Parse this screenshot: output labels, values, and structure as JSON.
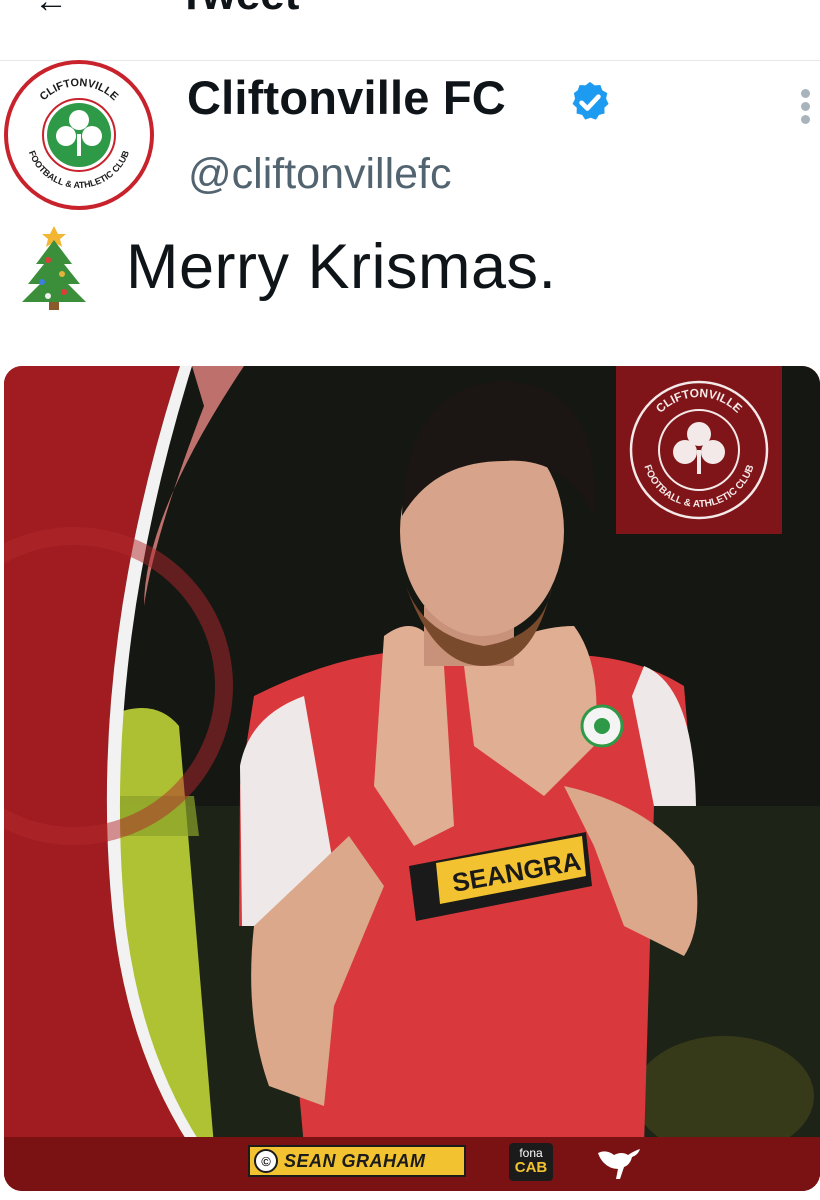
{
  "header": {
    "title": "Tweet",
    "back_icon": "arrow-left-icon"
  },
  "author": {
    "name": "Cliftonville FC",
    "handle": "@cliftonvillefc",
    "verified": true,
    "avatar_crest_top": "CLIFTONVILLE",
    "avatar_crest_bottom": "FOOTBALL & ATHLETIC CLUB"
  },
  "tweet": {
    "emoji": "christmas-tree-icon",
    "text": "Merry Krismas."
  },
  "media": {
    "crest_top": "CLIFTONVILLE",
    "crest_bottom": "FOOTBALL & ATHLETIC CLUB",
    "shirt_sponsor": "SEANGRA",
    "sponsors": {
      "sean_graham": "SEAN GRAHAM",
      "fona_top": "fona",
      "fona_bottom": "CAB"
    }
  },
  "colors": {
    "brand_red": "#c8232c",
    "verified_blue": "#1d9bf0",
    "handle_grey": "#536471"
  }
}
